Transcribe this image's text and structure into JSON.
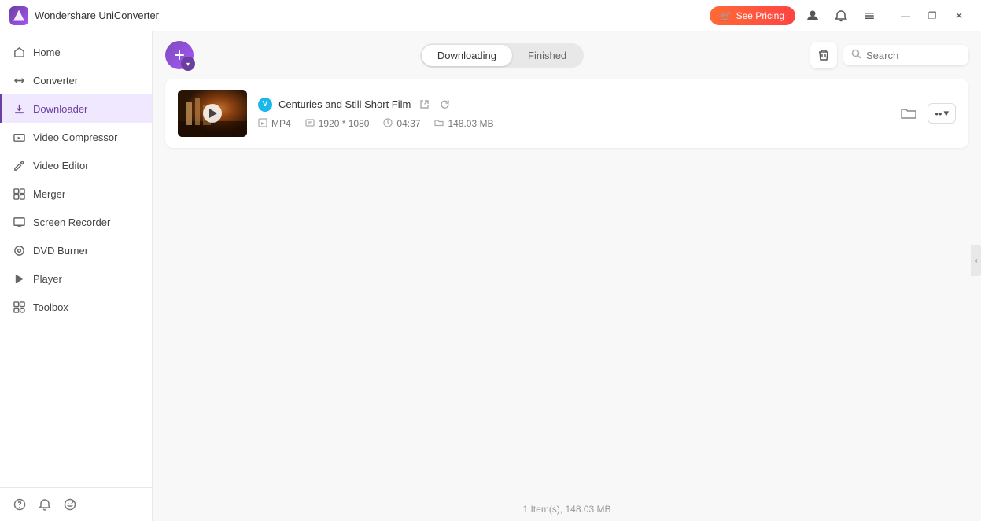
{
  "app": {
    "title": "Wondershare UniConverter",
    "logo_alt": "app-logo"
  },
  "titlebar": {
    "pricing_btn": "See Pricing",
    "minimize_label": "—",
    "maximize_label": "❐",
    "close_label": "✕"
  },
  "sidebar": {
    "items": [
      {
        "id": "home",
        "label": "Home",
        "icon": "🏠"
      },
      {
        "id": "converter",
        "label": "Converter",
        "icon": "⟳"
      },
      {
        "id": "downloader",
        "label": "Downloader",
        "icon": "⬇"
      },
      {
        "id": "video-compressor",
        "label": "Video Compressor",
        "icon": "🗜"
      },
      {
        "id": "video-editor",
        "label": "Video Editor",
        "icon": "✂"
      },
      {
        "id": "merger",
        "label": "Merger",
        "icon": "⊞"
      },
      {
        "id": "screen-recorder",
        "label": "Screen Recorder",
        "icon": "⊡"
      },
      {
        "id": "dvd-burner",
        "label": "DVD Burner",
        "icon": "⊙"
      },
      {
        "id": "player",
        "label": "Player",
        "icon": "▶"
      },
      {
        "id": "toolbox",
        "label": "Toolbox",
        "icon": "⊛"
      }
    ],
    "active": "downloader",
    "bottom_icons": [
      "?",
      "🔔",
      "↺"
    ]
  },
  "header": {
    "tabs": [
      {
        "id": "downloading",
        "label": "Downloading",
        "active": true
      },
      {
        "id": "finished",
        "label": "Finished",
        "active": false
      }
    ],
    "search_placeholder": "Search"
  },
  "download_items": [
    {
      "id": 1,
      "title": "Centuries and Still Short Film",
      "source": "vimeo",
      "source_label": "V",
      "format": "MP4",
      "resolution": "1920 * 1080",
      "duration": "04:37",
      "size": "148.03 MB",
      "thumbnail_alt": "video-thumbnail"
    }
  ],
  "footer": {
    "status": "1 Item(s), 148.03 MB"
  }
}
